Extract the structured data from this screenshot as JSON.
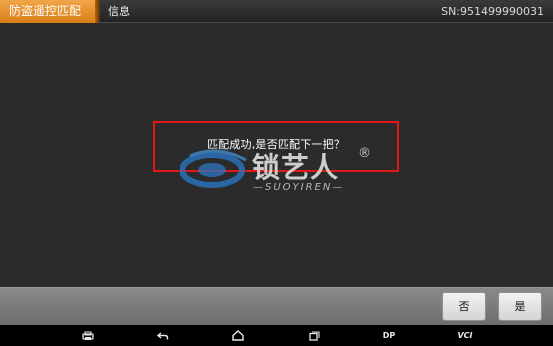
{
  "header": {
    "app_title": "防盗遥控匹配",
    "info_label": "信息",
    "serial": "SN:951499990031"
  },
  "dialog": {
    "message": "匹配成功,是否匹配下一把？"
  },
  "watermark": {
    "brand_cn": "锁艺人",
    "brand_en": "SUOYIREN",
    "registered_mark": "®"
  },
  "buttons": {
    "no_label": "否",
    "yes_label": "是"
  },
  "navbar": {
    "items": [
      {
        "icon": "printer-icon"
      },
      {
        "icon": "back-icon"
      },
      {
        "icon": "home-icon"
      },
      {
        "icon": "recents-icon"
      },
      {
        "label": "DP"
      },
      {
        "label": "VCI"
      }
    ]
  },
  "colors": {
    "accent": "#e58a22",
    "dialog_border": "#e01818"
  }
}
